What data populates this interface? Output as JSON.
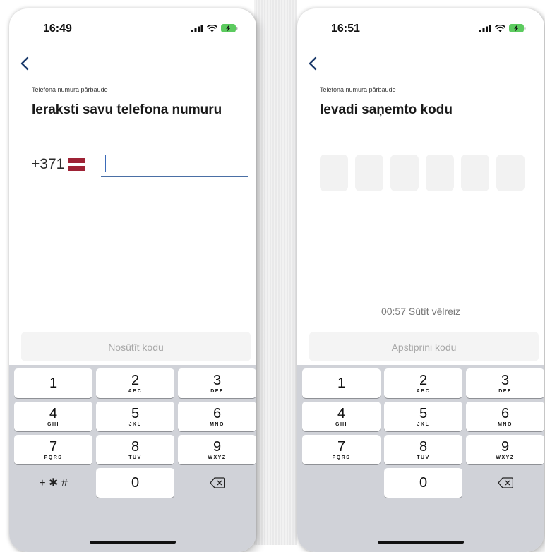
{
  "left": {
    "status": {
      "time": "16:49"
    },
    "subtitle": "Telefona numura pārbaude",
    "title": "Ieraksti savu telefona numuru",
    "prefix": "+371",
    "phone_value": "",
    "action_label": "Nosūtīt kodu",
    "keypad": {
      "keys": [
        {
          "digit": "1",
          "letters": ""
        },
        {
          "digit": "2",
          "letters": "ABC"
        },
        {
          "digit": "3",
          "letters": "DEF"
        },
        {
          "digit": "4",
          "letters": "GHI"
        },
        {
          "digit": "5",
          "letters": "JKL"
        },
        {
          "digit": "6",
          "letters": "MNO"
        },
        {
          "digit": "7",
          "letters": "PQRS"
        },
        {
          "digit": "8",
          "letters": "TUV"
        },
        {
          "digit": "9",
          "letters": "WXYZ"
        },
        {
          "digit": "0",
          "letters": ""
        }
      ],
      "symbols_label": "+ ✱ #"
    }
  },
  "right": {
    "status": {
      "time": "16:51"
    },
    "subtitle": "Telefona numura pārbaude",
    "title": "Ievadi saņemto kodu",
    "resend_text": "00:57 Sūtīt vēlreiz",
    "action_label": "Apstiprini kodu",
    "keypad": {
      "keys": [
        {
          "digit": "1",
          "letters": ""
        },
        {
          "digit": "2",
          "letters": "ABC"
        },
        {
          "digit": "3",
          "letters": "DEF"
        },
        {
          "digit": "4",
          "letters": "GHI"
        },
        {
          "digit": "5",
          "letters": "JKL"
        },
        {
          "digit": "6",
          "letters": "MNO"
        },
        {
          "digit": "7",
          "letters": "PQRS"
        },
        {
          "digit": "8",
          "letters": "TUV"
        },
        {
          "digit": "9",
          "letters": "WXYZ"
        },
        {
          "digit": "0",
          "letters": ""
        }
      ]
    }
  },
  "icons": {
    "signal": "signal-icon",
    "wifi": "wifi-icon",
    "battery": "battery-charging-icon",
    "back": "chevron-left-icon",
    "delete": "backspace-icon"
  },
  "colors": {
    "accent": "#3b6bb8",
    "flag_red": "#9e2235",
    "keypad_bg": "#d0d2d8",
    "disabled_text": "#a8a8a8"
  }
}
